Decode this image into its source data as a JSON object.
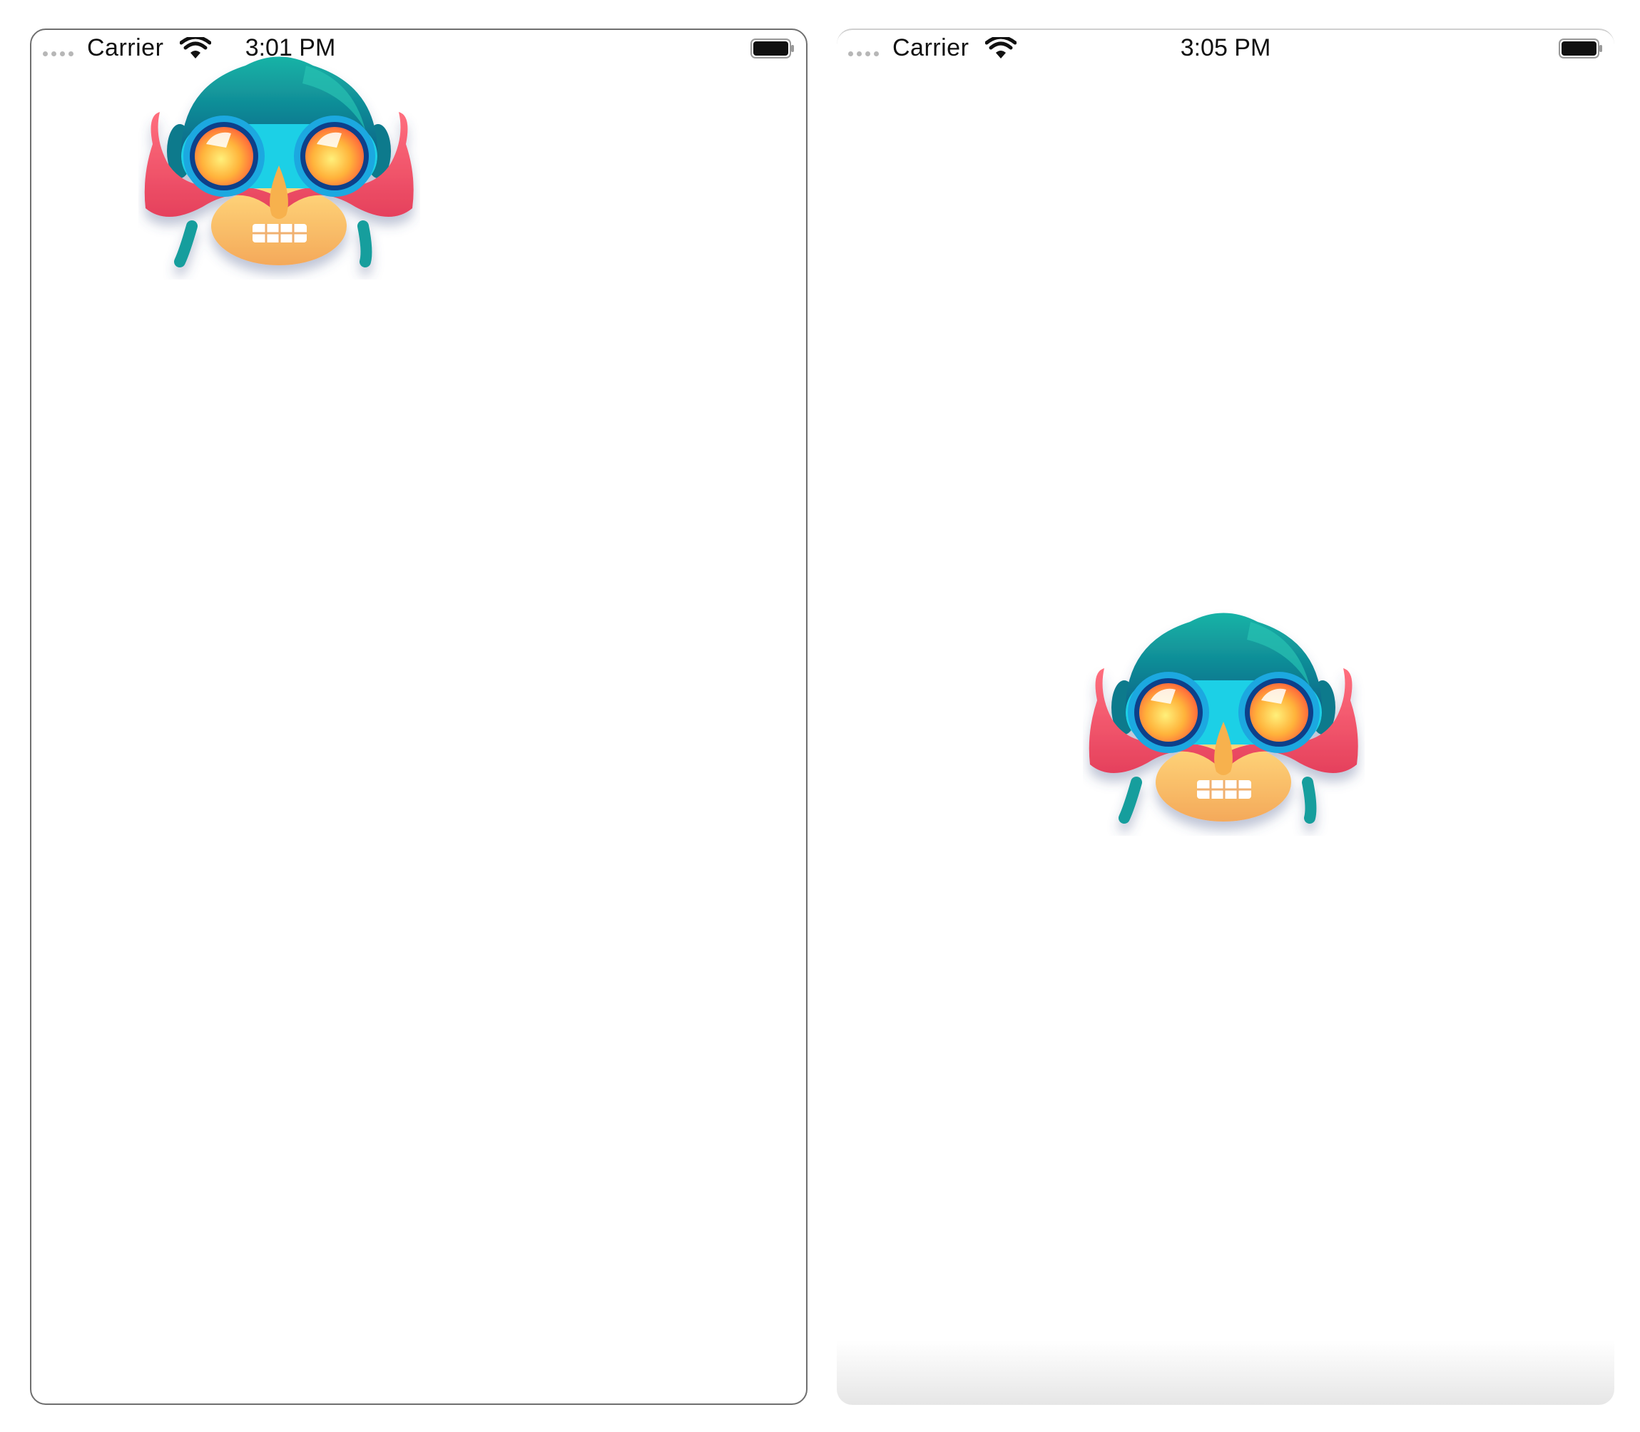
{
  "screens": [
    {
      "carrier": "Carrier",
      "time": "3:01 PM",
      "mascot_icon": "goggles-mustache-mascot-icon"
    },
    {
      "carrier": "Carrier",
      "time": "3:05 PM",
      "mascot_icon": "goggles-mustache-mascot-icon"
    }
  ],
  "colors": {
    "hair": "#0d8f93",
    "mustache": "#f2546a",
    "goggle_frame": "#27c5e8",
    "lens_center": "#ffd24a",
    "lens_edge": "#ff7a3c",
    "face": "#f9c56a"
  }
}
